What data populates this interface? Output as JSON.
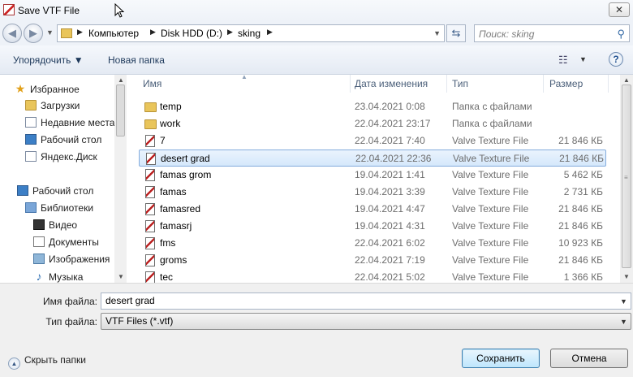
{
  "window": {
    "title": "Save VTF File",
    "close_glyph": "✕"
  },
  "nav": {
    "back_glyph": "◀",
    "forward_glyph": "▶",
    "breadcrumb": [
      "Компьютер",
      "Disk HDD (D:)",
      "sking"
    ],
    "search_placeholder": "Поиск: sking"
  },
  "toolbar": {
    "organize_label": "Упорядочить ▼",
    "new_folder_label": "Новая папка",
    "help_glyph": "?"
  },
  "sidebar": {
    "favorites": {
      "label": "Избранное",
      "items": [
        "Загрузки",
        "Недавние места",
        "Рабочий стол",
        "Яндекс.Диск"
      ]
    },
    "desktop": {
      "label": "Рабочий стол"
    },
    "libraries": {
      "label": "Библиотеки",
      "items": [
        "Видео",
        "Документы",
        "Изображения",
        "Музыка"
      ]
    }
  },
  "columns": {
    "name": "Имя",
    "date": "Дата изменения",
    "type": "Тип",
    "size": "Размер"
  },
  "files": [
    {
      "name": "temp",
      "date": "23.04.2021 0:08",
      "type": "Папка с файлами",
      "size": "",
      "icon": "folder-icon"
    },
    {
      "name": "work",
      "date": "22.04.2021 23:17",
      "type": "Папка с файлами",
      "size": "",
      "icon": "folder-icon"
    },
    {
      "name": "7",
      "date": "22.04.2021 7:40",
      "type": "Valve Texture File",
      "size": "21 846 КБ",
      "icon": "vtf-file-icon"
    },
    {
      "name": "desert grad",
      "date": "22.04.2021 22:36",
      "type": "Valve Texture File",
      "size": "21 846 КБ",
      "icon": "vtf-file-icon",
      "selected": true
    },
    {
      "name": "famas grom",
      "date": "19.04.2021 1:41",
      "type": "Valve Texture File",
      "size": "5 462 КБ",
      "icon": "vtf-file-icon"
    },
    {
      "name": "famas",
      "date": "19.04.2021 3:39",
      "type": "Valve Texture File",
      "size": "2 731 КБ",
      "icon": "vtf-file-icon"
    },
    {
      "name": "famasred",
      "date": "19.04.2021 4:47",
      "type": "Valve Texture File",
      "size": "21 846 КБ",
      "icon": "vtf-file-icon"
    },
    {
      "name": "famasrj",
      "date": "19.04.2021 4:31",
      "type": "Valve Texture File",
      "size": "21 846 КБ",
      "icon": "vtf-file-icon"
    },
    {
      "name": "fms",
      "date": "22.04.2021 6:02",
      "type": "Valve Texture File",
      "size": "10 923 КБ",
      "icon": "vtf-file-icon"
    },
    {
      "name": "groms",
      "date": "22.04.2021 7:19",
      "type": "Valve Texture File",
      "size": "21 846 КБ",
      "icon": "vtf-file-icon"
    },
    {
      "name": "tec",
      "date": "22.04.2021 5:02",
      "type": "Valve Texture File",
      "size": "1 366 КБ",
      "icon": "vtf-file-icon"
    }
  ],
  "form": {
    "filename_label": "Имя файла:",
    "filename_value": "desert grad",
    "filetype_label": "Тип файла:",
    "filetype_value": "VTF Files (*.vtf)"
  },
  "footer": {
    "hide_folders_label": "Скрыть папки",
    "save_label": "Сохранить",
    "cancel_label": "Отмена"
  },
  "colors": {
    "selection": "#d5e8fb",
    "selection_border": "#84acdd",
    "link_text": "#1e395b"
  }
}
